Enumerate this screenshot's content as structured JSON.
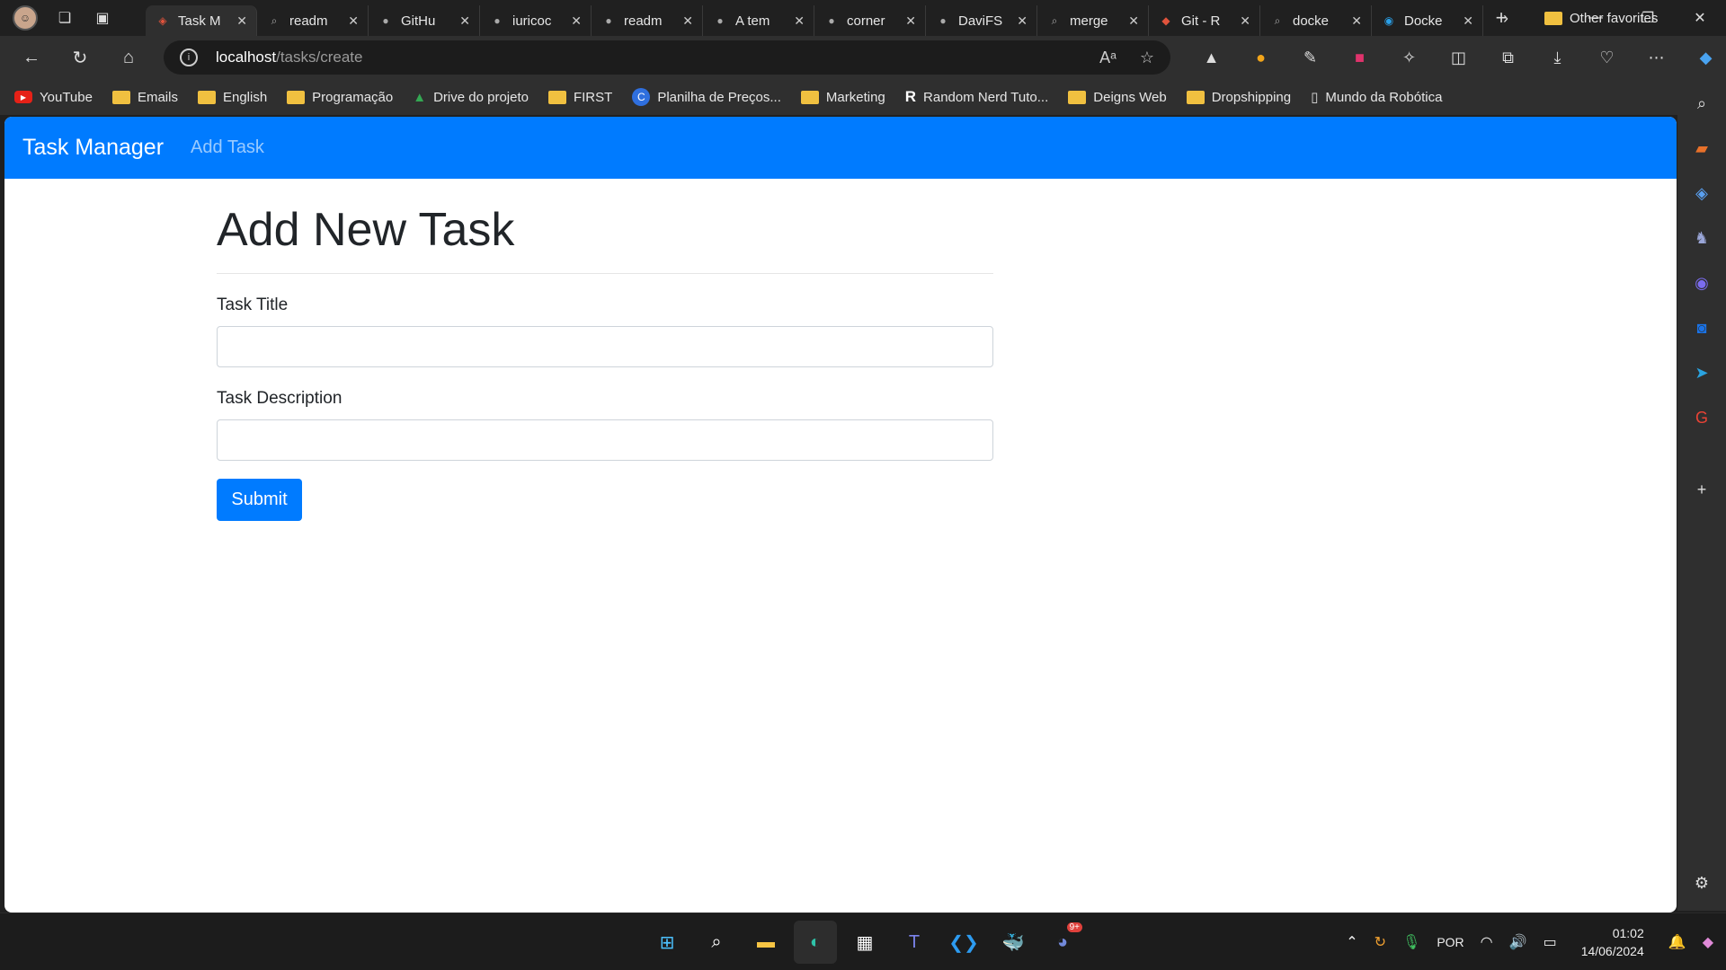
{
  "browser": {
    "tabs": [
      {
        "title": "Task M",
        "icon": "laravel-icon",
        "active": true
      },
      {
        "title": "readm",
        "icon": "search-icon"
      },
      {
        "title": "GitHu",
        "icon": "github-icon"
      },
      {
        "title": "iuricoc",
        "icon": "github-icon"
      },
      {
        "title": "readm",
        "icon": "github-icon"
      },
      {
        "title": "A tem",
        "icon": "github-icon"
      },
      {
        "title": "corner",
        "icon": "github-icon"
      },
      {
        "title": "DaviFS",
        "icon": "github-icon"
      },
      {
        "title": "merge",
        "icon": "search-icon"
      },
      {
        "title": "Git - R",
        "icon": "git-icon"
      },
      {
        "title": "docke",
        "icon": "search-icon"
      },
      {
        "title": "Docke",
        "icon": "docker-icon"
      }
    ],
    "url_host": "localhost",
    "url_path": "/tasks/create",
    "bookmarks": [
      {
        "label": "YouTube",
        "icon": "youtube-icon"
      },
      {
        "label": "Emails",
        "icon": "folder-icon"
      },
      {
        "label": "English",
        "icon": "folder-icon"
      },
      {
        "label": "Programação",
        "icon": "folder-icon"
      },
      {
        "label": "Drive do projeto",
        "icon": "drive-icon"
      },
      {
        "label": "FIRST",
        "icon": "folder-icon"
      },
      {
        "label": "Planilha de Preços...",
        "icon": "c-icon"
      },
      {
        "label": "Marketing",
        "icon": "folder-icon"
      },
      {
        "label": "Random Nerd Tuto...",
        "icon": "r-icon"
      },
      {
        "label": "Deigns Web",
        "icon": "folder-icon"
      },
      {
        "label": "Dropshipping",
        "icon": "folder-icon"
      },
      {
        "label": "Mundo da Robótica",
        "icon": "page-icon"
      }
    ],
    "other_favorites": "Other favorites"
  },
  "app": {
    "brand": "Task Manager",
    "nav_add_task": "Add Task",
    "heading": "Add New Task",
    "title_label": "Task Title",
    "title_value": "",
    "description_label": "Task Description",
    "description_value": "",
    "submit_label": "Submit"
  },
  "taskbar": {
    "language": "POR",
    "time": "01:02",
    "date": "14/06/2024",
    "discord_badge": "9+"
  },
  "colors": {
    "primary": "#007bff",
    "chrome_dark": "#202020",
    "chrome_toolbar": "#2f2f2f"
  }
}
